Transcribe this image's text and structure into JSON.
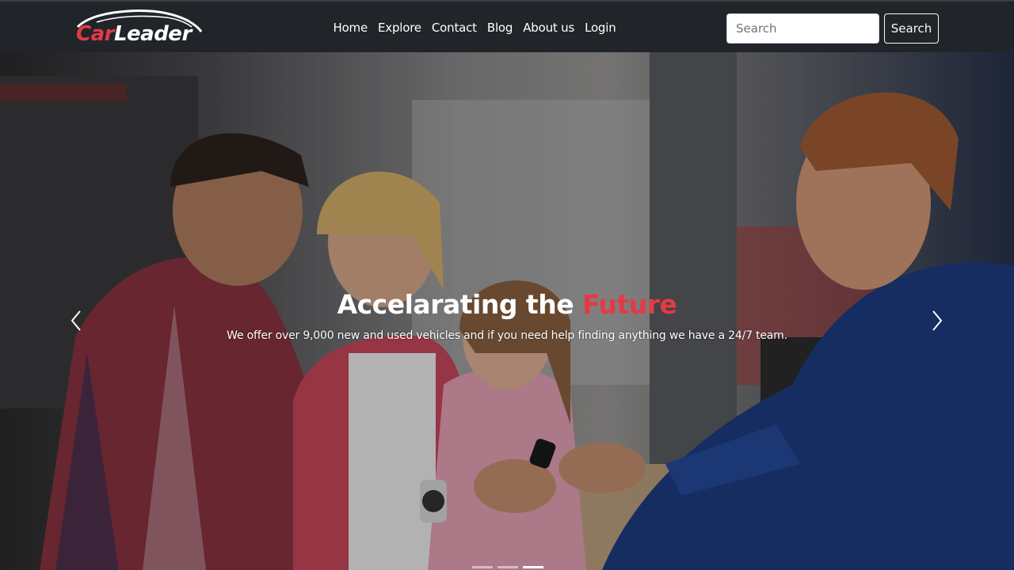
{
  "brand": {
    "part1": "Car",
    "part2": "Leader"
  },
  "nav": {
    "links": [
      "Home",
      "Explore",
      "Contact",
      "Blog",
      "About us",
      "Login"
    ]
  },
  "search": {
    "placeholder": "Search",
    "button_label": "Search"
  },
  "hero": {
    "title_main": "Accelarating the ",
    "title_accent": "Future",
    "subtitle": "We offer over 9,000 new and used vehicles and if you need help finding anything we have a 24/7 team.",
    "slide_count": 3,
    "active_slide": 3
  },
  "colors": {
    "accent": "#e63946",
    "navbar": "#212529"
  },
  "icons": {
    "prev": "chevron-left-icon",
    "next": "chevron-right-icon"
  }
}
